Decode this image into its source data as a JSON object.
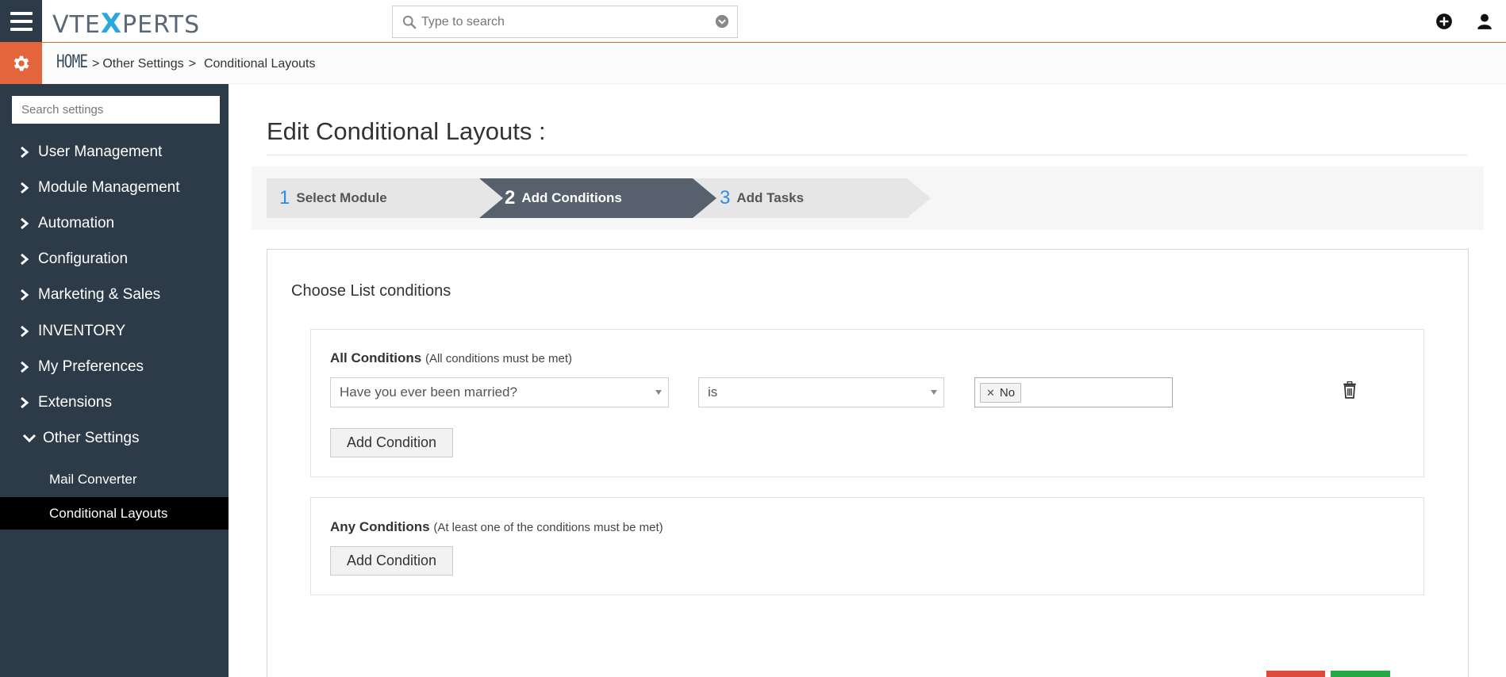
{
  "header": {
    "logo_prefix": "VTE",
    "logo_x": "X",
    "logo_suffix": "PERTS",
    "search_placeholder": "Type to search",
    "icons": [
      "hamburger-menu-icon",
      "search-icon",
      "chevron-down-circle-icon",
      "plus-circle-icon",
      "user-icon"
    ]
  },
  "breadcrumb": {
    "home": "HOME",
    "items": [
      "Other Settings",
      "Conditional Layouts"
    ]
  },
  "sidebar": {
    "search_placeholder": "Search settings",
    "items": [
      {
        "label": "User Management"
      },
      {
        "label": "Module Management"
      },
      {
        "label": "Automation"
      },
      {
        "label": "Configuration"
      },
      {
        "label": "Marketing & Sales"
      },
      {
        "label": "INVENTORY"
      },
      {
        "label": "My Preferences"
      },
      {
        "label": "Extensions"
      },
      {
        "label": "Other Settings"
      }
    ],
    "subitems": [
      {
        "label": "Mail Converter"
      },
      {
        "label": "Conditional Layouts"
      }
    ],
    "colors": {
      "background": "#2d3b48",
      "active": "#000000"
    }
  },
  "main": {
    "title": "Edit Conditional Layouts :",
    "wizard": {
      "steps": [
        {
          "num": "1",
          "label": "Select Module"
        },
        {
          "num": "2",
          "label": "Add Conditions"
        },
        {
          "num": "3",
          "label": "Add Tasks"
        }
      ],
      "active_step": "2"
    },
    "panel_title": "Choose List conditions",
    "all_conditions": {
      "label": "All Conditions",
      "hint": "(All conditions must be met)",
      "field": "Have you ever been married?",
      "operator": "is",
      "value_tag": "No",
      "add_button": "Add Condition"
    },
    "any_conditions": {
      "label": "Any Conditions",
      "hint": "(At least one of the conditions must be met)",
      "add_button": "Add Condition"
    }
  },
  "colors": {
    "accent": "#e4643c",
    "step_number": "#2e8de0",
    "cancel": "#dd4b39",
    "save": "#27a845"
  }
}
